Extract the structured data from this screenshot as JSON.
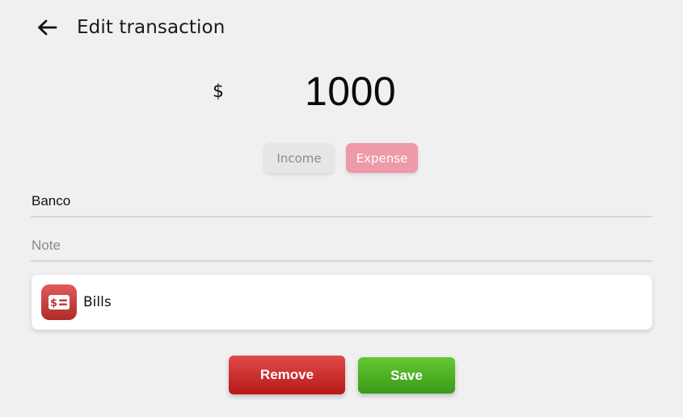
{
  "header": {
    "title": "Edit transaction",
    "back_icon": "arrow-left-icon"
  },
  "amount": {
    "currency_symbol": "$",
    "value": "1000"
  },
  "type_toggle": {
    "income_label": "Income",
    "expense_label": "Expense",
    "selected": "Expense",
    "income_color": "#e6e6e6",
    "expense_color": "#ef9aa8"
  },
  "fields": {
    "account_value": "Banco",
    "note_placeholder": "Note",
    "note_value": ""
  },
  "category": {
    "icon": "bill-icon",
    "label": "Bills",
    "icon_color": "#c93a3a"
  },
  "actions": {
    "remove_label": "Remove",
    "save_label": "Save",
    "remove_color": "#c92a2a",
    "save_color": "#4fae22"
  }
}
